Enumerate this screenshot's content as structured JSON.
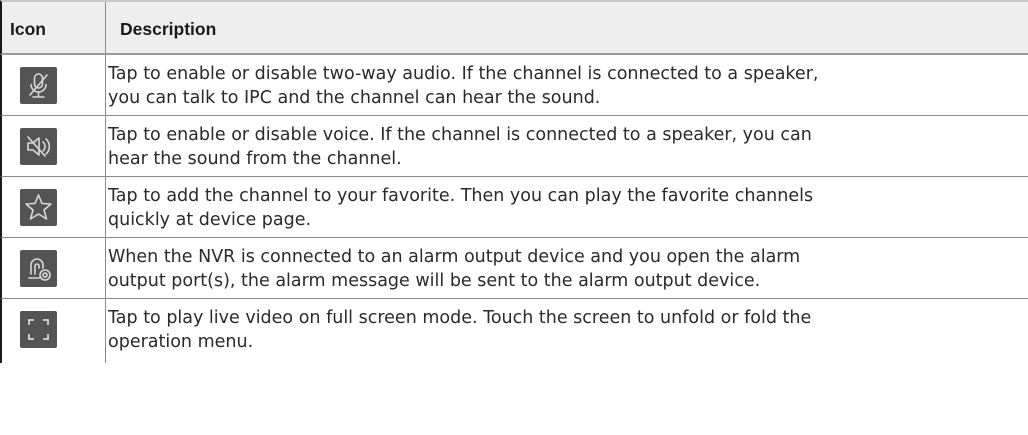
{
  "table": {
    "headers": {
      "icon": "Icon",
      "description": "Description"
    },
    "rows": [
      {
        "icon": "microphone-muted-icon",
        "line1": "Tap to enable or disable two-way audio. If the channel is connected to a speaker,",
        "line2": "you can talk to IPC and the channel can hear the sound."
      },
      {
        "icon": "speaker-muted-icon",
        "line1": "Tap to enable or disable voice. If the channel is connected to a speaker, you can",
        "line2": "hear the sound from the channel."
      },
      {
        "icon": "star-icon",
        "line1": "Tap to add the channel to your favorite. Then you can play the favorite channels",
        "line2": "quickly at device page."
      },
      {
        "icon": "alarm-output-icon",
        "line1": "When the NVR is connected to an alarm output device and you open the alarm",
        "line2": "output port(s), the alarm message will be sent to the alarm output device."
      },
      {
        "icon": "fullscreen-icon",
        "line1": "Tap to play live video on full screen mode. Touch the screen to unfold or fold the",
        "line2": "operation menu."
      }
    ]
  }
}
